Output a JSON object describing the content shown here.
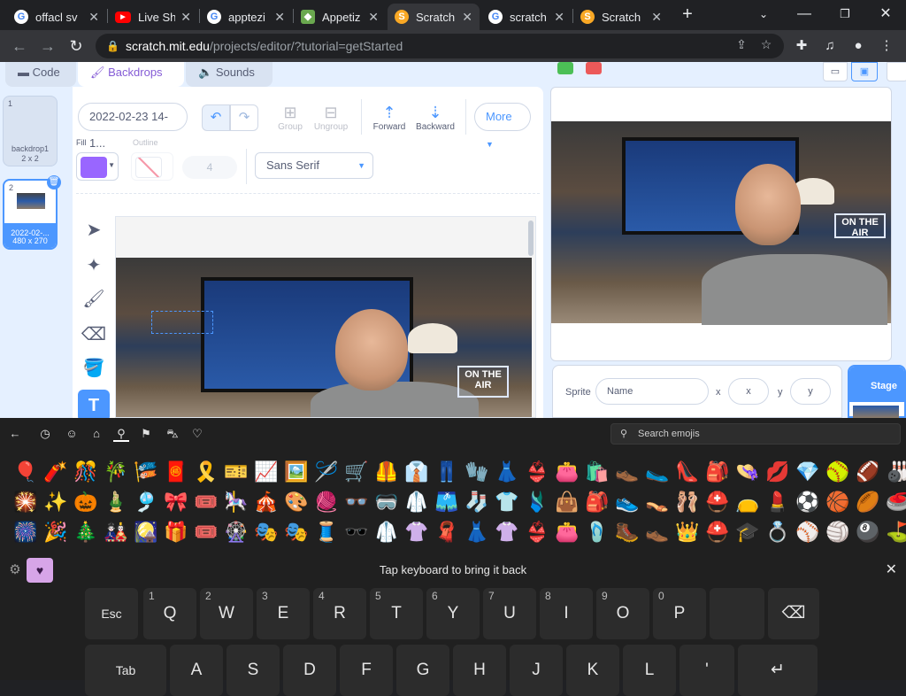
{
  "browser": {
    "tabs": [
      {
        "title": "offacl sv",
        "icon": "google-icon",
        "active": false
      },
      {
        "title": "Live Sh",
        "icon": "youtube-icon",
        "active": false
      },
      {
        "title": "apptezi",
        "icon": "google-icon",
        "active": false
      },
      {
        "title": "Appetiz",
        "icon": "cube-icon",
        "active": false
      },
      {
        "title": "Scratch",
        "icon": "scratch-icon",
        "active": true
      },
      {
        "title": "scratch",
        "icon": "google-icon",
        "active": false
      },
      {
        "title": "Scratch",
        "icon": "scratch-icon",
        "active": false
      }
    ],
    "new_tab": "+",
    "url_host": "scratch.mit.edu",
    "url_path": "/projects/editor/?tutorial=getStarted"
  },
  "scratch": {
    "editor_tabs": {
      "code": "Code",
      "backdrops": "Backdrops",
      "sounds": "Sounds"
    },
    "backdrops": [
      {
        "num": "1",
        "name": "backdrop1",
        "dims": "2 x 2",
        "selected": false
      },
      {
        "num": "2",
        "name": "2022-02-...",
        "dims": "480 x 270",
        "selected": true
      }
    ],
    "paint": {
      "costume_name": "2022-02-23 14-1...",
      "group": "Group",
      "ungroup": "Ungroup",
      "forward": "Forward",
      "backward": "Backward",
      "more": "More",
      "fill_label": "Fill",
      "outline_label": "Outline",
      "outline_width": "4",
      "font": "Sans Serif",
      "fill_color": "#9966ff"
    },
    "sign_text": "ON THE AIR",
    "target": {
      "sprite_label": "Sprite",
      "name_placeholder": "Name",
      "x_label": "x",
      "x_placeholder": "x",
      "y_label": "y",
      "y_placeholder": "y",
      "stage_label": "Stage"
    }
  },
  "emoji_panel": {
    "search_placeholder": "Search emojis",
    "rows": [
      [
        "🎈",
        "🧨",
        "🎊",
        "🎋",
        "🎏",
        "🧧",
        "🎗️",
        "🎫",
        "📈",
        "🖼️",
        "🪡",
        "🛒",
        "🦺",
        "👔",
        "👖",
        "🧤",
        "👗",
        "👙",
        "👛",
        "🛍️",
        "👞",
        "🥿",
        "👠",
        "🎒",
        "👒",
        "💋",
        "💎",
        "🥎",
        "🏈",
        "🎳"
      ],
      [
        "🎇",
        "✨",
        "🎃",
        "🎍",
        "🎐",
        "🎀",
        "🎟️",
        "🎠",
        "🎪",
        "🎨",
        "🧶",
        "👓",
        "🥽",
        "🥼",
        "🩳",
        "🧦",
        "👕",
        "🩱",
        "👜",
        "🎒",
        "👟",
        "👡",
        "🩰",
        "⛑️",
        "👝",
        "💄",
        "⚽",
        "🏀",
        "🏉",
        "🥌"
      ],
      [
        "🎆",
        "🎉",
        "🎄",
        "🎎",
        "🎑",
        "🎁",
        "🎟️",
        "🎡",
        "🎭",
        "🎭",
        "🧵",
        "🕶️",
        "🥼",
        "👚",
        "🧣",
        "👗",
        "👚",
        "👙",
        "👛",
        "🩴",
        "🥾",
        "👞",
        "👑",
        "⛑️",
        "🎓",
        "💍",
        "⚾",
        "🏐",
        "🎱",
        "⛳"
      ]
    ]
  },
  "keyboard": {
    "hint": "Tap keyboard to bring it back",
    "row1": [
      {
        "label": "Esc",
        "hint": ""
      },
      {
        "label": "Q",
        "hint": "1"
      },
      {
        "label": "W",
        "hint": "2"
      },
      {
        "label": "E",
        "hint": "3"
      },
      {
        "label": "R",
        "hint": "4"
      },
      {
        "label": "T",
        "hint": "5"
      },
      {
        "label": "Y",
        "hint": "6"
      },
      {
        "label": "U",
        "hint": "7"
      },
      {
        "label": "I",
        "hint": "8"
      },
      {
        "label": "O",
        "hint": "9"
      },
      {
        "label": "P",
        "hint": "0"
      },
      {
        "label": "",
        "hint": ""
      },
      {
        "label": "⌫",
        "hint": ""
      }
    ],
    "row2": [
      {
        "label": "Tab"
      },
      {
        "label": "A"
      },
      {
        "label": "S"
      },
      {
        "label": "D"
      },
      {
        "label": "F"
      },
      {
        "label": "G"
      },
      {
        "label": "H"
      },
      {
        "label": "J"
      },
      {
        "label": "K"
      },
      {
        "label": "L"
      },
      {
        "label": "'"
      },
      {
        "label": "↵"
      }
    ]
  }
}
